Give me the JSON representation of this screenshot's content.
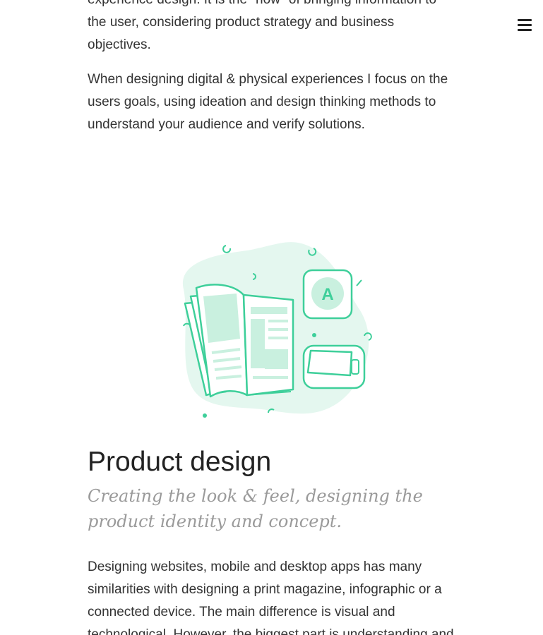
{
  "nav": {
    "menu_icon": "hamburger-menu-icon"
  },
  "intro": {
    "paragraph_1": "experience design. It is the \"how\" of bringing information to the user, considering product strategy and business objectives.",
    "paragraph_2": "When designing digital & physical experiences I focus on the users goals, using ideation and design thinking methods to understand your audience and verify solutions."
  },
  "product_design": {
    "illustration": {
      "icon": "magazine-devices-illustration",
      "badge_letter": "A"
    },
    "title": "Product design",
    "subtitle": "Creating the look & feel, designing the product identity and concept.",
    "body": "Designing websites, mobile and desktop apps has many similarities with designing a print magazine, infographic or a connected device. The main difference is visual and technological. However, the biggest part is understanding and"
  },
  "colors": {
    "accent": "#3ecf9a",
    "accent_light": "#e4f7ef",
    "text": "#333333",
    "subtitle": "#9a9a9a"
  }
}
